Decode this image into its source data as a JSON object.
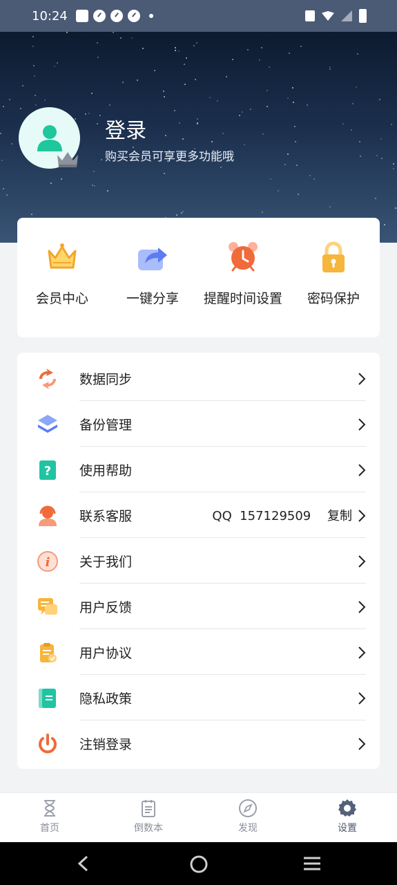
{
  "status_bar": {
    "time": "10:24"
  },
  "profile": {
    "title": "登录",
    "subtitle": "购买会员可享更多功能哦"
  },
  "quick_actions": [
    {
      "label": "会员中心",
      "icon": "crown-icon"
    },
    {
      "label": "一键分享",
      "icon": "share-icon"
    },
    {
      "label": "提醒时间设置",
      "icon": "alarm-clock-icon"
    },
    {
      "label": "密码保护",
      "icon": "lock-icon"
    }
  ],
  "menu": [
    {
      "label": "数据同步",
      "icon": "sync-icon"
    },
    {
      "label": "备份管理",
      "icon": "layers-icon"
    },
    {
      "label": "使用帮助",
      "icon": "help-icon"
    },
    {
      "label": "联系客服",
      "icon": "customer-service-icon",
      "extra": "QQ  157129509",
      "action": "复制"
    },
    {
      "label": "关于我们",
      "icon": "info-icon"
    },
    {
      "label": "用户反馈",
      "icon": "feedback-icon"
    },
    {
      "label": "用户协议",
      "icon": "clipboard-icon"
    },
    {
      "label": "隐私政策",
      "icon": "book-icon"
    },
    {
      "label": "注销登录",
      "icon": "power-icon"
    }
  ],
  "bottom_nav": [
    {
      "label": "首页",
      "icon": "hourglass-icon"
    },
    {
      "label": "倒数本",
      "icon": "notebook-icon"
    },
    {
      "label": "发现",
      "icon": "compass-icon"
    },
    {
      "label": "设置",
      "icon": "gear-icon",
      "active": true
    }
  ],
  "colors": {
    "header_top": "#0d1b30",
    "header_bottom": "#395475",
    "accent_orange": "#f06a3a",
    "accent_blue": "#5b7cf2",
    "accent_teal": "#20c4a3",
    "accent_yellow": "#f6b53b"
  }
}
